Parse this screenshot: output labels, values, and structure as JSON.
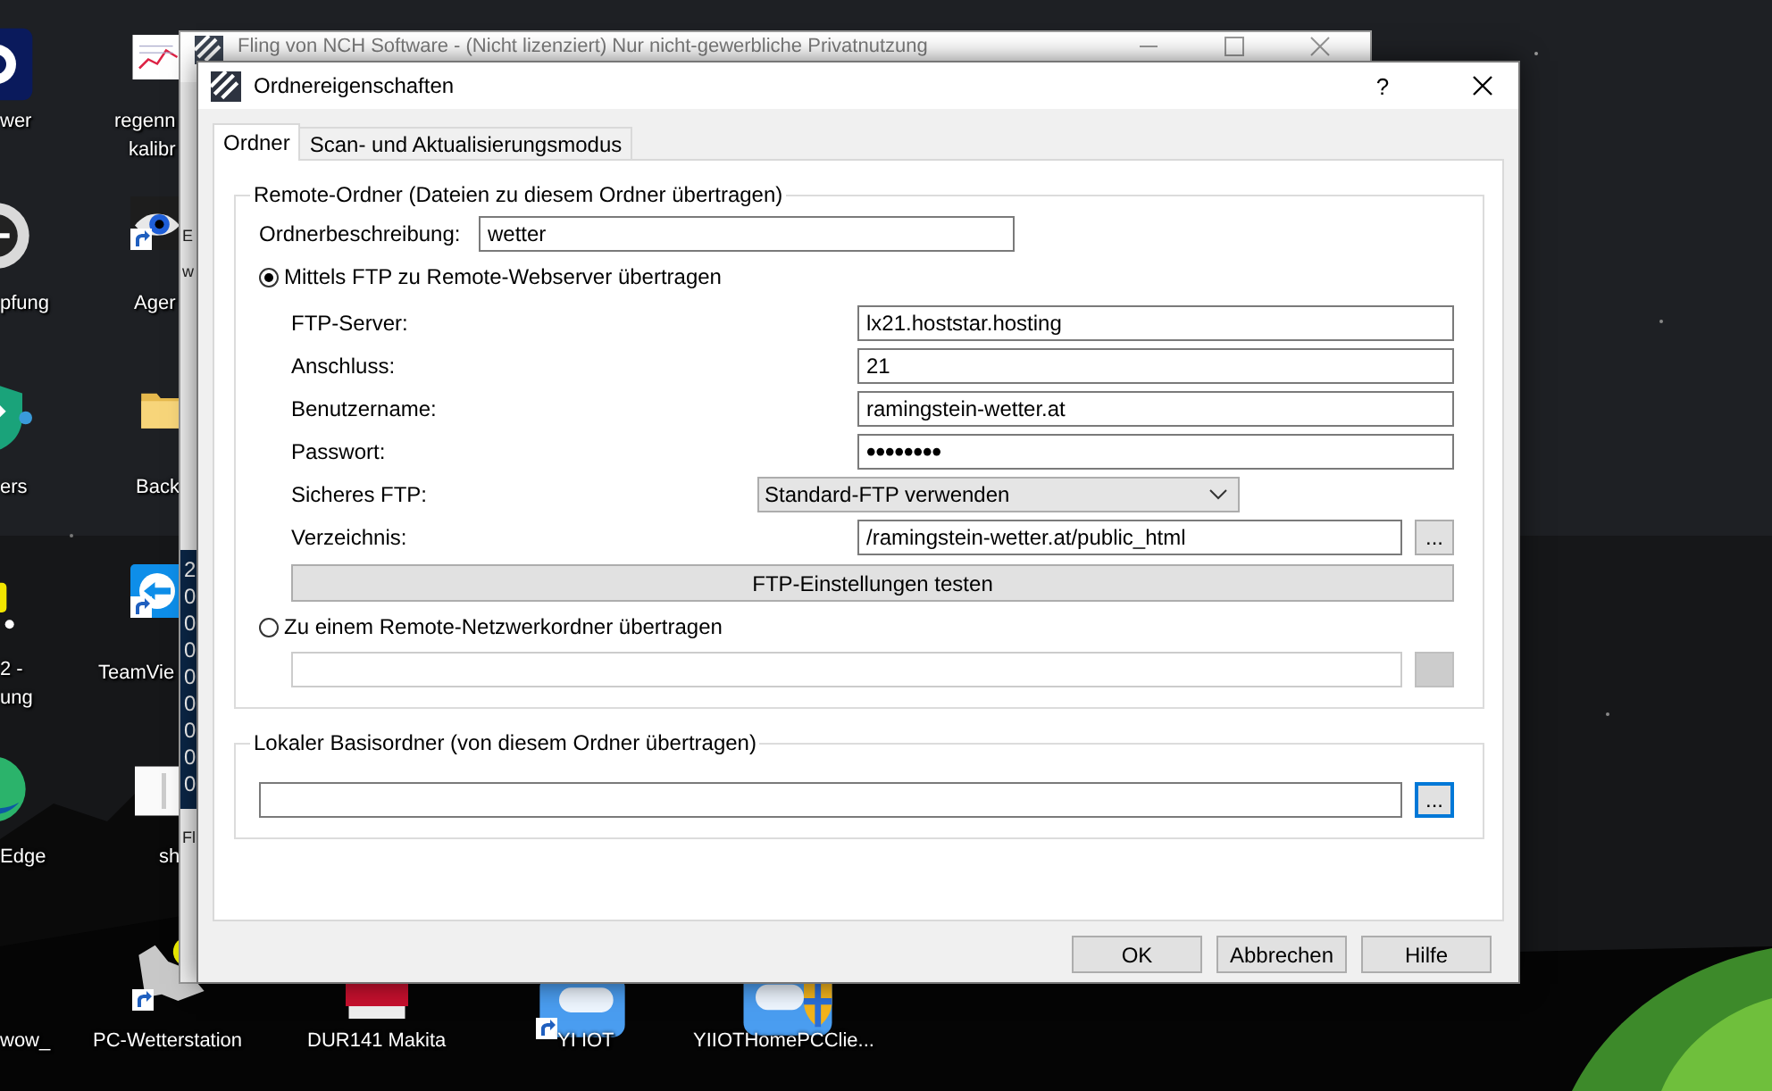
{
  "desktop_icons": [
    {
      "kind": "app-dark",
      "labels": [
        "wer"
      ],
      "shortcut": false
    },
    {
      "kind": "round-app",
      "labels": [
        "pfung"
      ],
      "shortcut": false
    },
    {
      "kind": "shield",
      "labels": [
        "ers"
      ],
      "shortcut": false
    },
    {
      "kind": "yellow-app",
      "labels": [
        "2 -",
        "ung"
      ],
      "shortcut": false
    },
    {
      "kind": "edge",
      "labels": [
        "Edge"
      ],
      "shortcut": false
    },
    {
      "kind": "none",
      "labels": [
        "wow_"
      ],
      "shortcut": false
    },
    {
      "kind": "chart-document",
      "labels": [
        "regenn",
        "kalibr"
      ],
      "shortcut": false
    },
    {
      "kind": "eye",
      "labels": [
        "Ager"
      ],
      "shortcut": true
    },
    {
      "kind": "folder",
      "labels": [
        "Back"
      ],
      "shortcut": false
    },
    {
      "kind": "remote-app",
      "labels": [
        "TeamVie"
      ],
      "shortcut": true
    },
    {
      "kind": "document",
      "labels": [
        "sh"
      ],
      "shortcut": false
    },
    {
      "kind": "weather",
      "labels": [
        "PC-Wetterstation"
      ],
      "shortcut": true
    },
    {
      "kind": "pdf",
      "labels": [
        "DUR141 Makita"
      ],
      "shortcut": false
    },
    {
      "kind": "cloud",
      "labels": [
        "YI IOT"
      ],
      "shortcut": true
    },
    {
      "kind": "cloud-shield",
      "labels": [
        "YIIOTHomePCClie..."
      ],
      "shortcut": false
    }
  ],
  "background_window": {
    "title": "Fling von NCH Software - (Nicht lizenziert) Nur nicht-gewerbliche Privatnutzung",
    "fragments": [
      "E",
      "w"
    ],
    "list_rows": [
      "2",
      "0",
      "0",
      "0",
      "0",
      "0",
      "0",
      "0",
      "0"
    ],
    "footer_fragment": "Fl"
  },
  "dialog": {
    "title": "Ordnereigenschaften",
    "help_button": "?",
    "tabs": [
      {
        "label": "Ordner",
        "selected": true
      },
      {
        "label": "Scan- und Aktualisierungsmodus",
        "selected": false
      }
    ],
    "remote_group": {
      "title": "Remote-Ordner (Dateien zu diesem Ordner übertragen)",
      "description": {
        "label": "Ordnerbeschreibung:",
        "value": "wetter"
      },
      "ftp_option": {
        "label": "Mittels FTP zu Remote-Webserver übertragen",
        "selected": true
      },
      "ftp_fields": [
        {
          "kind": "text",
          "label": "FTP-Server:",
          "value": "lx21.hoststar.hosting"
        },
        {
          "kind": "text",
          "label": "Anschluss:",
          "value": "21"
        },
        {
          "kind": "text",
          "label": "Benutzername:",
          "value": "ramingstein-wetter.at"
        },
        {
          "kind": "password",
          "label": "Passwort:",
          "value": "••••••••"
        },
        {
          "kind": "select",
          "label": "Sicheres FTP:",
          "value": "Standard-FTP verwenden"
        },
        {
          "kind": "browse",
          "label": "Verzeichnis:",
          "value": "/ramingstein-wetter.at/public_html",
          "button": "...",
          "focused": false
        }
      ],
      "test_button": "FTP-Einstellungen testen",
      "network_option": {
        "label": "Zu einem Remote-Netzwerkordner übertragen",
        "selected": false
      },
      "network_path": {
        "disabled": true
      }
    },
    "local_group": {
      "title": "Lokaler Basisordner (von diesem Ordner übertragen)",
      "browse_button": {
        "label": "...",
        "focused": true
      }
    },
    "buttons": [
      "OK",
      "Abbrechen",
      "Hilfe"
    ]
  }
}
